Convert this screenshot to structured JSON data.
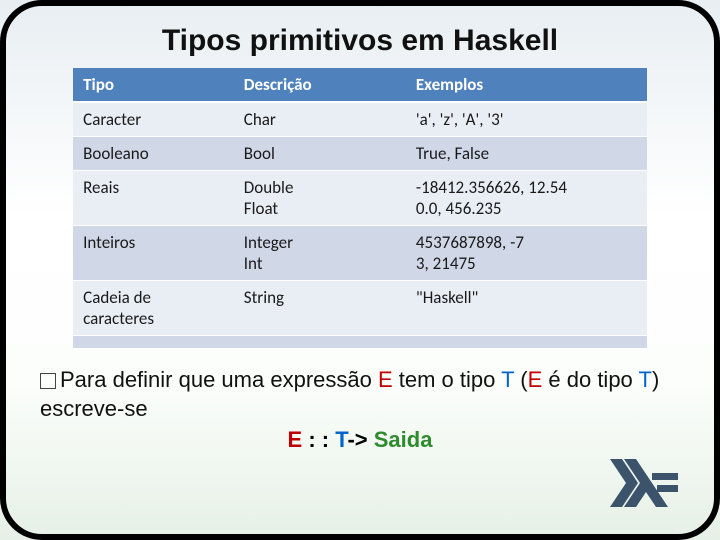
{
  "title": "Tipos primitivos em Haskell",
  "headers": {
    "c0": "Tipo",
    "c1": "Descrição",
    "c2": "Exemplos"
  },
  "rows": [
    {
      "c0": "Caracter",
      "c1": "Char",
      "c2": "'a', 'z', 'A', '3'"
    },
    {
      "c0": "Booleano",
      "c1": "Bool",
      "c2": "True, False"
    },
    {
      "c0": "Reais",
      "c1": "Double\nFloat",
      "c2": "-18412.356626, 12.54\n0.0, 456.235"
    },
    {
      "c0": "Inteiros",
      "c1": "Integer\nInt",
      "c2": "4537687898, -7\n3, 21475"
    },
    {
      "c0": "Cadeia de caracteres",
      "c1": "String",
      "c2": "\"Haskell\""
    },
    {
      "c0": "",
      "c1": "",
      "c2": ""
    }
  ],
  "para": {
    "p1": "Para definir que uma expressão ",
    "e1": "E",
    "p2": " tem o tipo ",
    "t1": "T",
    "p3": " (",
    "e2": "E",
    "p4": " é do tipo ",
    "t2": "T",
    "p5": ") escreve-se"
  },
  "expr": {
    "e": "E",
    "mid": " : : ",
    "t": "T",
    "arrow": "-> ",
    "out": "Saida"
  },
  "logo_name": "haskell-logo"
}
